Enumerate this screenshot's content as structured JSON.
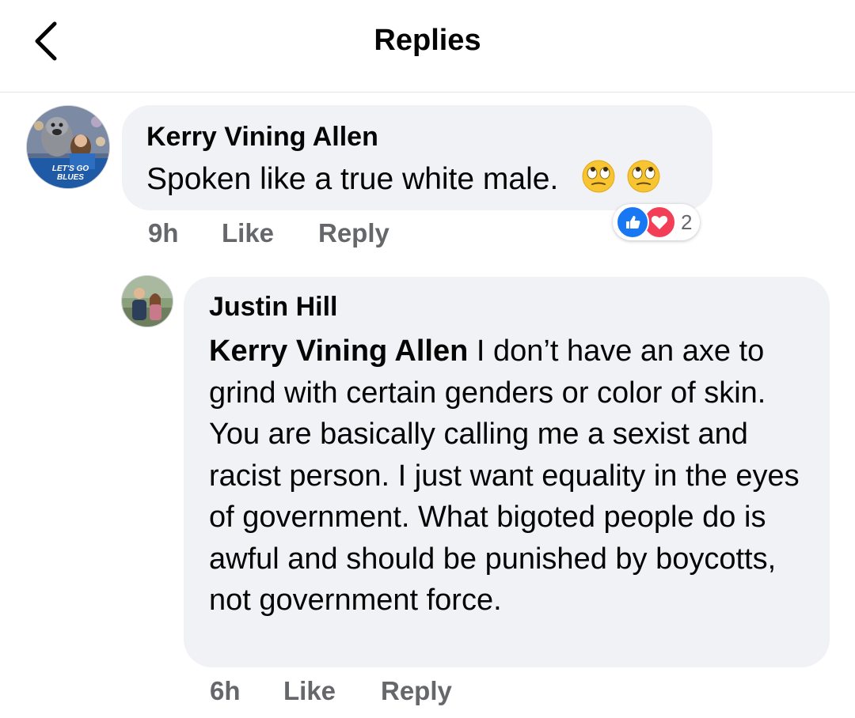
{
  "header": {
    "title": "Replies",
    "back_icon": "chevron-left-icon"
  },
  "comments": [
    {
      "author": "Kerry Vining Allen",
      "text": "Spoken like a true white male.",
      "emoji": [
        "face-with-rolling-eyes",
        "face-with-rolling-eyes"
      ],
      "time": "9h",
      "like_label": "Like",
      "reply_label": "Reply",
      "reactions": {
        "types": [
          "like",
          "love"
        ],
        "count": "2"
      },
      "avatar_caption": "LET'S GO BLUES"
    },
    {
      "author": "Justin Hill",
      "mention": "Kerry Vining Allen",
      "text": " I don’t have an axe to grind with certain genders or color of skin. You are basically calling me a sexist and racist person. I just want equality in the eyes of government. What bigoted people do is awful and should be punished by boycotts, not government force.",
      "time": "6h",
      "like_label": "Like",
      "reply_label": "Reply"
    }
  ],
  "colors": {
    "bubble": "#f0f2f5",
    "meta_text": "#65676b",
    "like_blue": "#1877f2",
    "love_red": "#f33e58"
  }
}
